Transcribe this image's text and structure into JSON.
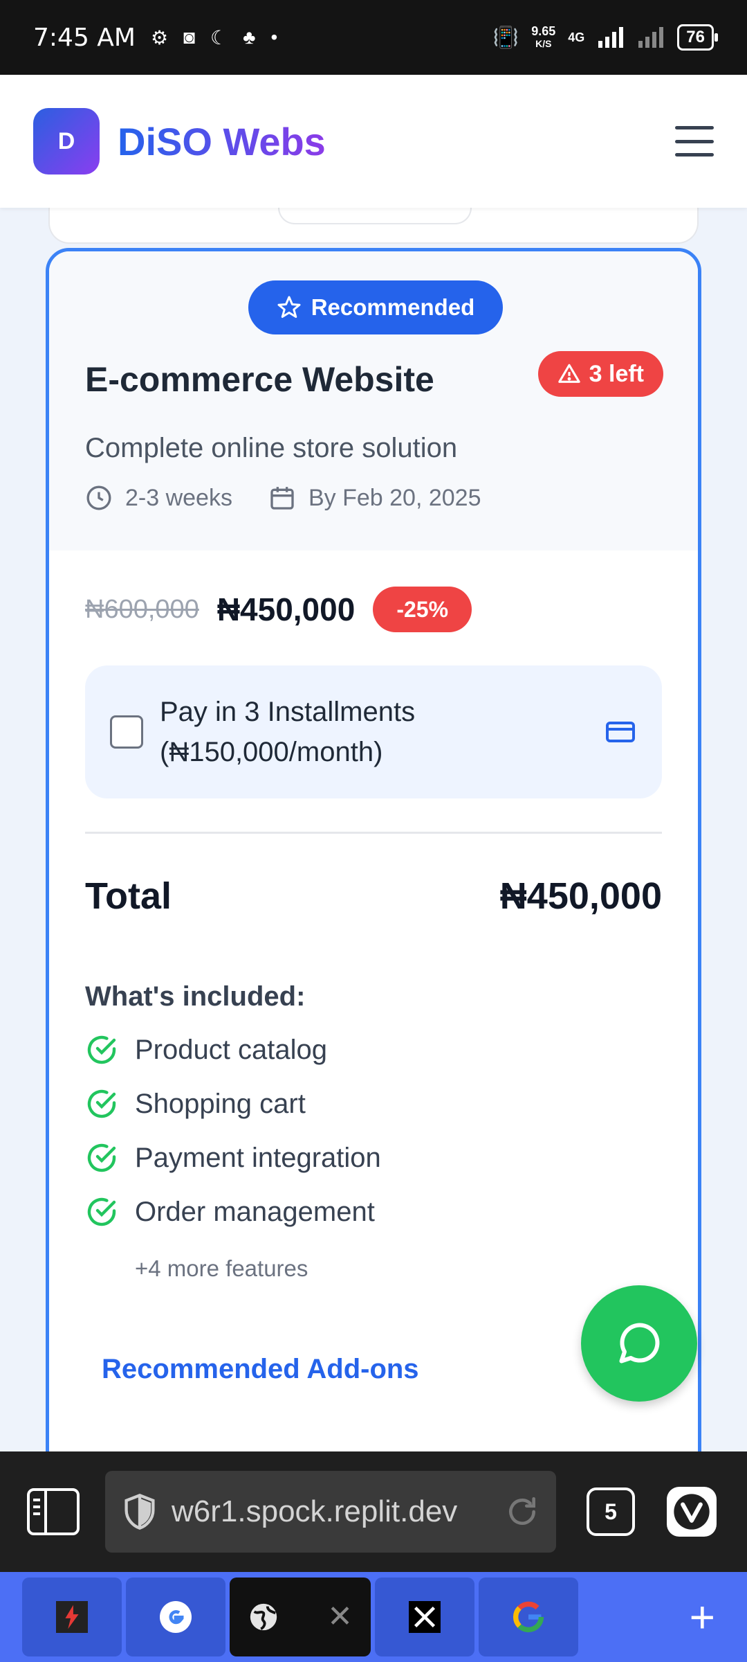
{
  "status_bar": {
    "time": "7:45 AM",
    "net_speed_value": "9.65",
    "net_speed_unit": "K/S",
    "network": "4G",
    "battery": "76"
  },
  "header": {
    "logo_letter": "D",
    "brand": "DiSO Webs"
  },
  "card": {
    "badge": "Recommended",
    "title": "E-commerce Website",
    "stock_badge": "3 left",
    "description": "Complete online store solution",
    "duration": "2-3 weeks",
    "deadline": "By Feb 20, 2025",
    "old_price": "₦600,000",
    "new_price": "₦450,000",
    "discount": "-25%",
    "installment_line1": "Pay in 3 Installments",
    "installment_line2": "(₦150,000/month)",
    "installment_checked": false,
    "total_label": "Total",
    "total_value": "₦450,000",
    "included_title": "What's included:",
    "features": [
      "Product catalog",
      "Shopping cart",
      "Payment integration",
      "Order management"
    ],
    "more_features": "+4 more features",
    "addons_link": "Recommended Add-ons"
  },
  "browser": {
    "url": "w6r1.spock.replit.dev",
    "tab_count": "5"
  },
  "colors": {
    "accent": "#2563eb",
    "danger": "#ef4444",
    "success": "#22c55e"
  }
}
